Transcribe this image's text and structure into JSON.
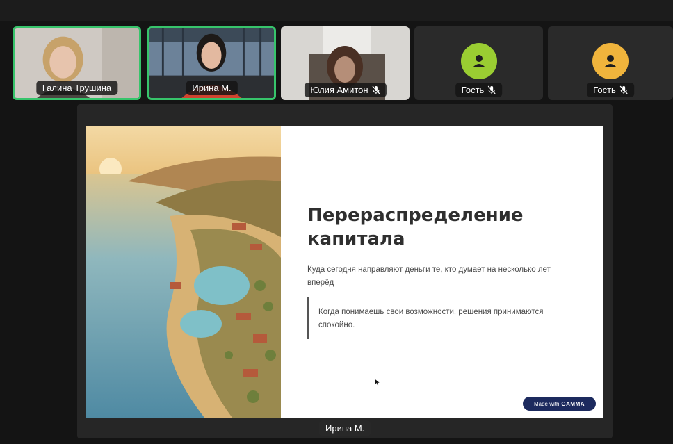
{
  "participants": [
    {
      "name": "Галина Трушина",
      "speaking": true,
      "mic_muted": false,
      "video": true
    },
    {
      "name": "Ирина М.",
      "speaking": true,
      "mic_muted": false,
      "video": true
    },
    {
      "name": "Юлия Амитон",
      "speaking": false,
      "mic_muted": true,
      "video": true
    },
    {
      "name": "Гость",
      "speaking": false,
      "mic_muted": true,
      "video": false,
      "avatar_color": "#9acd32"
    },
    {
      "name": "Гость",
      "speaking": false,
      "mic_muted": true,
      "video": false,
      "avatar_color": "#f0b43c"
    }
  ],
  "slide": {
    "title": "Перераспределение капитала",
    "subtitle": "Куда сегодня направляют деньги те, кто думает на несколько лет вперёд",
    "quote": "Когда понимаешь свои возможности, решения принимаются спокойно.",
    "badge_prefix": "Made with",
    "badge_brand": "GAMMA"
  },
  "presenter_label": "Ирина М.",
  "colors": {
    "speaking_border": "#37c46b",
    "badge_bg": "#1c2a5e"
  }
}
